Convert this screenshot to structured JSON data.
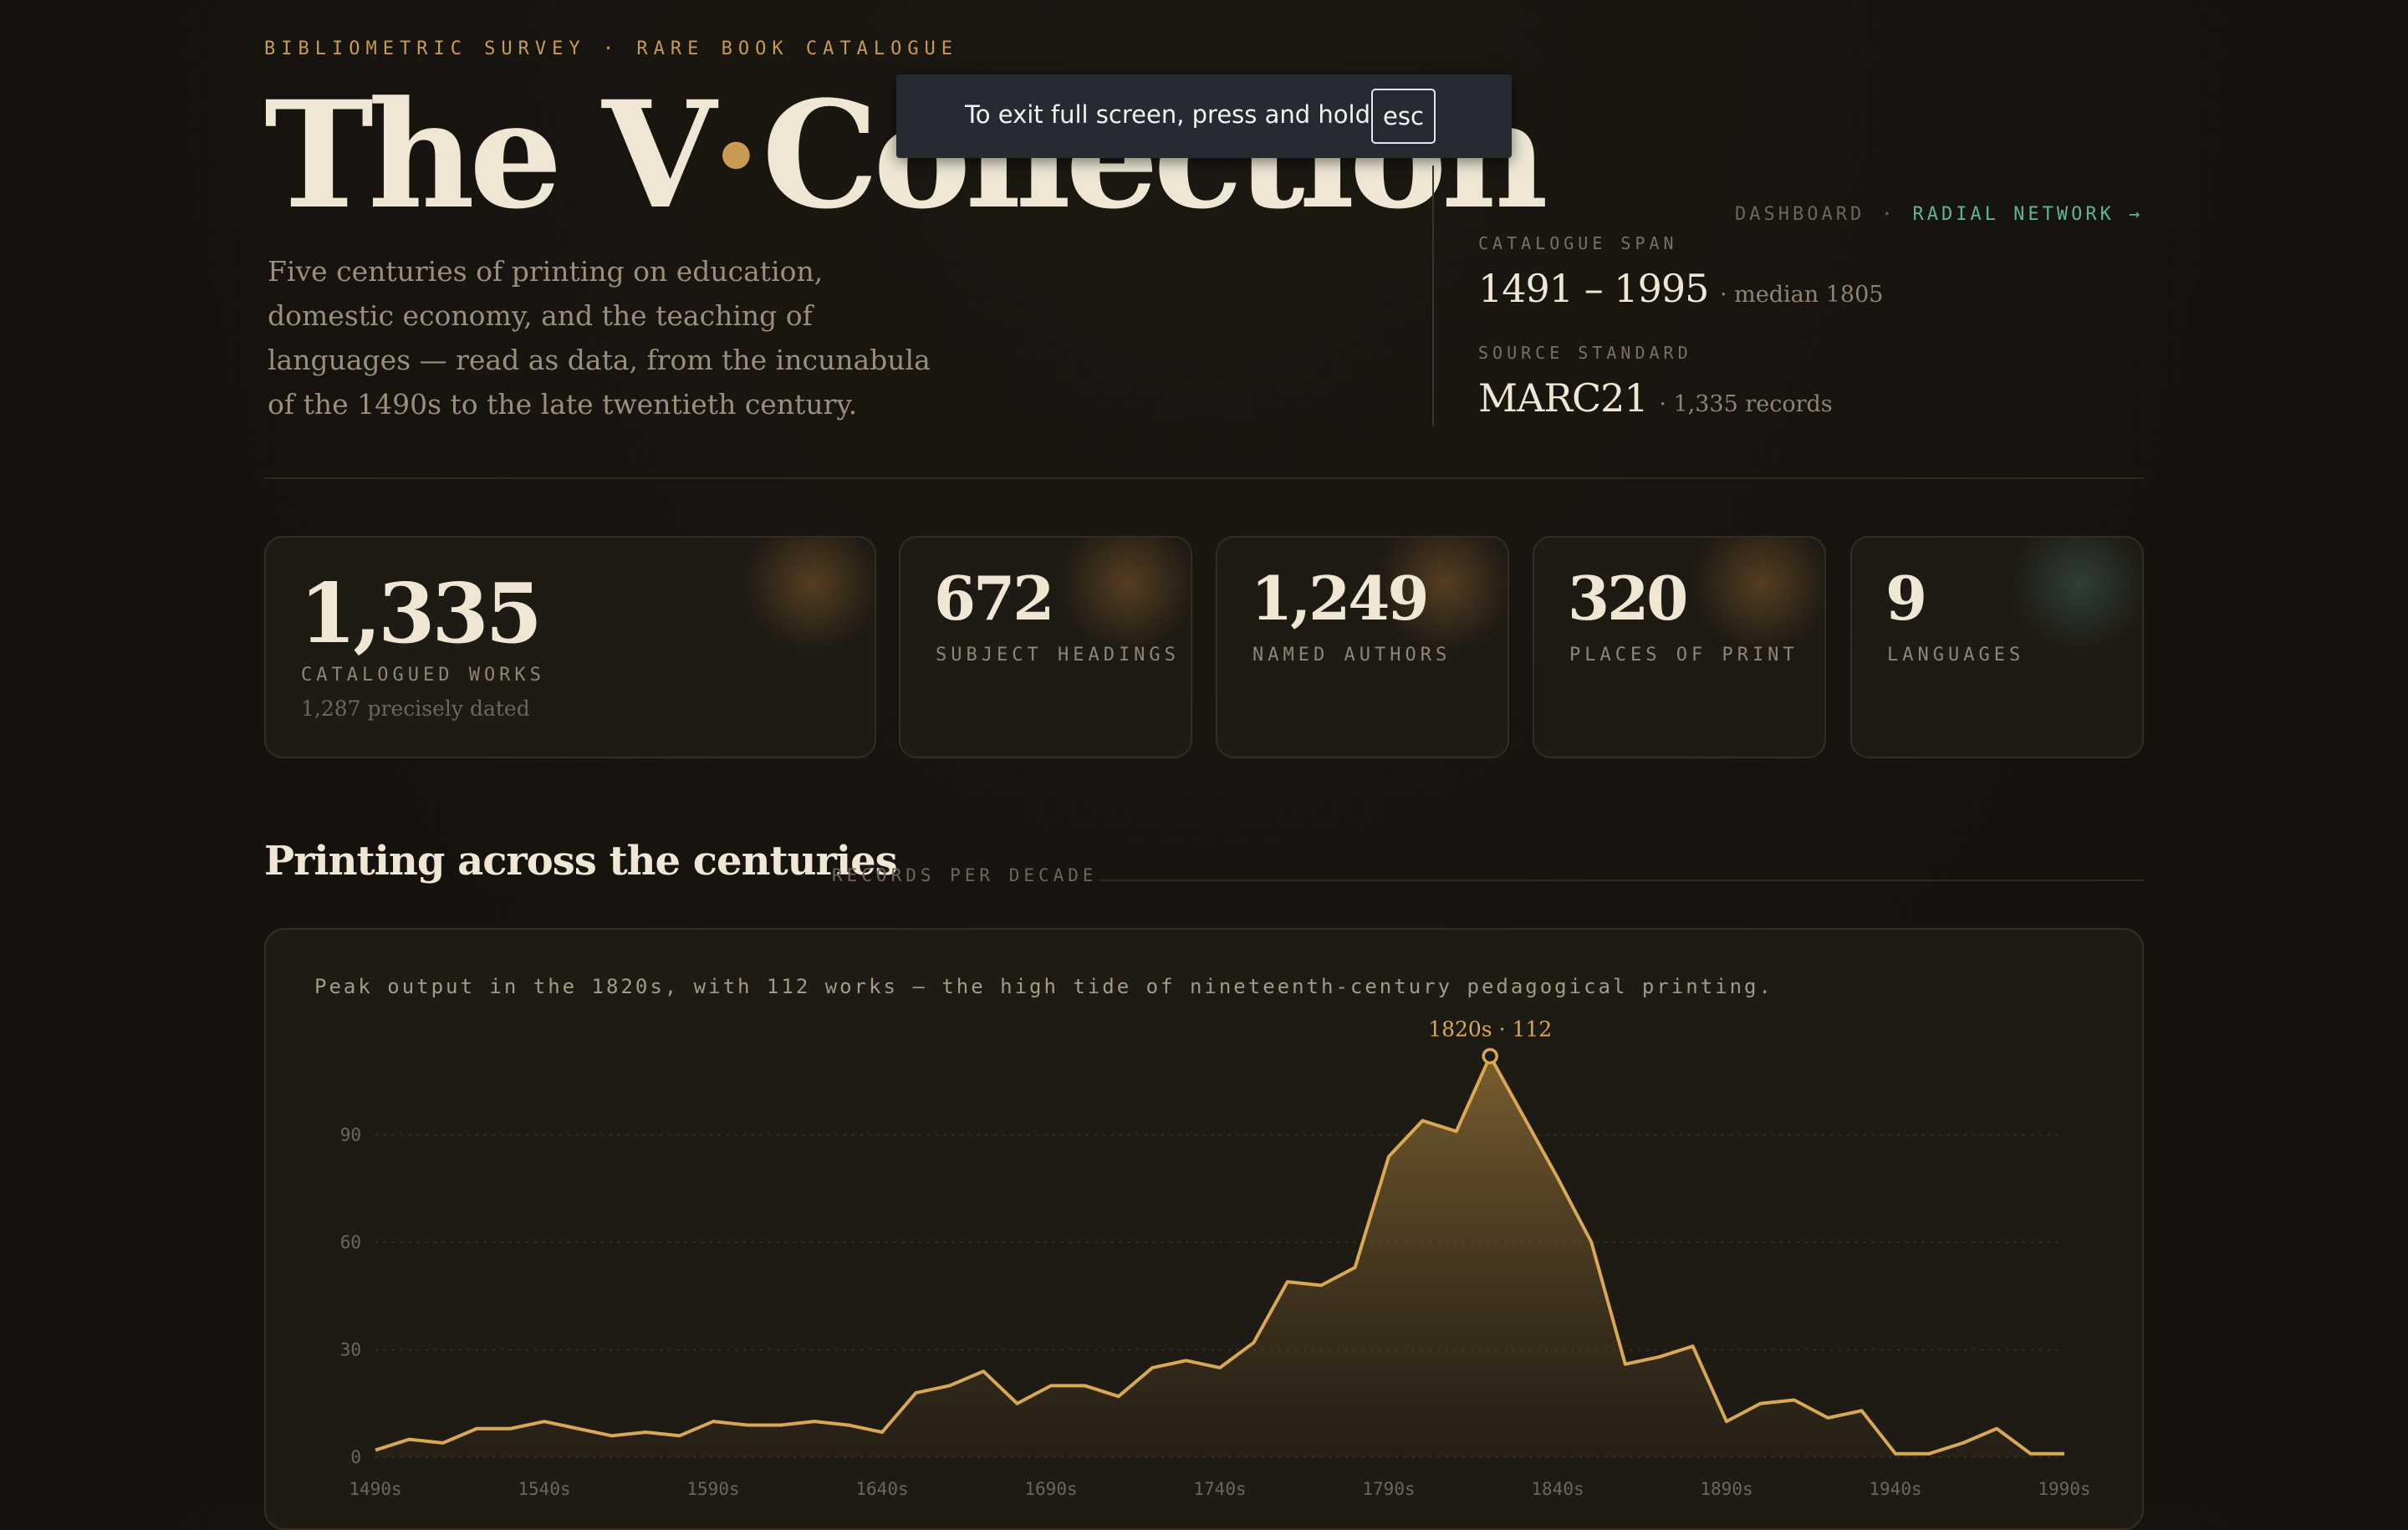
{
  "header": {
    "kicker": "BIBLIOMETRIC SURVEY · RARE BOOK CATALOGUE",
    "title_part1": "The V",
    "title_dot": "·",
    "title_part2": "Collection",
    "intro": "Five centuries of printing on education, domestic economy, and the teaching of languages — read as data, from the incunabula of the 1490s to the late twentieth century."
  },
  "nav": {
    "dashboard": "DASHBOARD",
    "separator": "·",
    "radial": "RADIAL NETWORK →"
  },
  "meta": {
    "span_label": "CATALOGUE SPAN",
    "span_value": "1491 – 1995",
    "span_note": "· median 1805",
    "source_label": "SOURCE STANDARD",
    "source_value": "MARC21",
    "source_note": "· 1,335 records"
  },
  "stats": [
    {
      "value": "1,335",
      "label": "CATALOGUED WORKS",
      "sub": "1,287 precisely dated"
    },
    {
      "value": "672",
      "label": "SUBJECT HEADINGS"
    },
    {
      "value": "1,249",
      "label": "NAMED AUTHORS"
    },
    {
      "value": "320",
      "label": "PLACES OF PRINT"
    },
    {
      "value": "9",
      "label": "LANGUAGES"
    }
  ],
  "section": {
    "title": "Printing across the centuries",
    "subtitle": "RECORDS PER DECADE"
  },
  "chart_caption": "Peak output in the 1820s, with 112 works — the high tide of nineteenth-century pedagogical printing.",
  "chart_data": {
    "type": "area",
    "x": [
      "1490s",
      "1500s",
      "1510s",
      "1520s",
      "1530s",
      "1540s",
      "1550s",
      "1560s",
      "1570s",
      "1580s",
      "1590s",
      "1600s",
      "1610s",
      "1620s",
      "1630s",
      "1640s",
      "1650s",
      "1660s",
      "1670s",
      "1680s",
      "1690s",
      "1700s",
      "1710s",
      "1720s",
      "1730s",
      "1740s",
      "1750s",
      "1760s",
      "1770s",
      "1780s",
      "1790s",
      "1800s",
      "1810s",
      "1820s",
      "1830s",
      "1840s",
      "1850s",
      "1860s",
      "1870s",
      "1880s",
      "1890s",
      "1900s",
      "1910s",
      "1920s",
      "1930s",
      "1940s",
      "1950s",
      "1960s",
      "1970s",
      "1980s",
      "1990s"
    ],
    "values": [
      2,
      5,
      4,
      8,
      8,
      10,
      8,
      6,
      7,
      6,
      10,
      9,
      9,
      10,
      9,
      7,
      18,
      20,
      24,
      15,
      20,
      20,
      17,
      25,
      27,
      25,
      32,
      49,
      48,
      53,
      84,
      94,
      91,
      112,
      95,
      78,
      60,
      26,
      28,
      31,
      10,
      15,
      16,
      11,
      13,
      1,
      1,
      4,
      8,
      1,
      1
    ],
    "x_tick_labels": [
      "1490s",
      "1540s",
      "1590s",
      "1640s",
      "1690s",
      "1740s",
      "1790s",
      "1840s",
      "1890s",
      "1940s",
      "1990s"
    ],
    "y_ticks": [
      0,
      30,
      60,
      90
    ],
    "ylim": [
      0,
      120
    ],
    "grid": true,
    "peak_label": "1820s · 112",
    "line_color": "#d9a852"
  },
  "toast": {
    "text": "To exit full screen, press and hold",
    "key": "esc"
  }
}
